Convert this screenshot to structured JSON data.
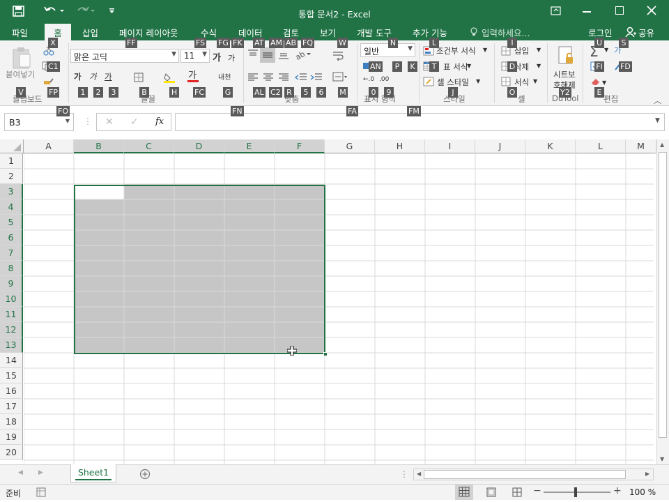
{
  "window": {
    "title": "통합 문서2  -  Excel"
  },
  "colors": {
    "accent": "#217346",
    "selection_fill": "#c6c6c6",
    "keytip_bg": "#5a5a5a"
  },
  "tabs": [
    "파일",
    "홈",
    "삽입",
    "페이지 레이아웃",
    "수식",
    "데이터",
    "검토",
    "보기",
    "개발 도구",
    "추가 기능"
  ],
  "tell_me": {
    "placeholder": "입력하세요..."
  },
  "account": {
    "login": "로그인",
    "share": "공유"
  },
  "ribbon": {
    "paste_label": "붙여넣기",
    "font_name": "맑은 고딕",
    "font_size": "11",
    "number_format": "일반",
    "conditional_format": "조건부 서식",
    "format_as_table": "표 서식",
    "cell_styles": "셀 스타일",
    "insert": "삽입",
    "delete": "삭제",
    "format": "서식",
    "sheet_protect_1": "시트보",
    "sheet_protect_2": "호해제",
    "groups": {
      "clipboard": "클립보드",
      "font": "글꼴",
      "alignment": "맞춤",
      "number": "표시 형식",
      "styles": "스타일",
      "cells": "셀",
      "dutool": "DuTool",
      "editing": "편집"
    }
  },
  "keytips": {
    "tab_home": "X",
    "format_painter": "FP",
    "copy": "C1",
    "paste": "V",
    "font_name": "FF",
    "font_size": "FS",
    "grow": "FG",
    "shrink": "FK",
    "top_align": "AT",
    "middle_align": "AM",
    "bottom_align": "AB",
    "orientation": "FQ",
    "wrap": "W",
    "number_format": "N",
    "conditional": "L",
    "insert": "I",
    "autosum": "U",
    "sort": "S",
    "bold": "1",
    "italic": "2",
    "underline": "3",
    "border": "B",
    "fill": "H",
    "font_color": "FC",
    "phonetic": "G",
    "align_left": "AL",
    "align_center": "C2",
    "align_right": "R",
    "dec_indent": "5",
    "inc_indent": "6",
    "merge": "M",
    "accounting": "AN",
    "percent": "P",
    "comma": "K",
    "table": "T",
    "delete": "D",
    "fill_down": "FI",
    "find": "FD",
    "inc_decimal": "0",
    "dec_decimal": "9",
    "cell_styles": "J",
    "format": "O",
    "unprotect": "Y2",
    "clear": "E",
    "font_dialog": "FN",
    "align_dialog": "FA",
    "number_dialog": "FM",
    "clipboard_dialog": "FO"
  },
  "formula_bar": {
    "name_box": "B3",
    "fx": "fx",
    "formula": ""
  },
  "columns": [
    "A",
    "B",
    "C",
    "D",
    "E",
    "F",
    "G",
    "H",
    "I",
    "J",
    "K",
    "L",
    "M"
  ],
  "rows": [
    "1",
    "2",
    "3",
    "4",
    "5",
    "6",
    "7",
    "8",
    "9",
    "10",
    "11",
    "12",
    "13",
    "14",
    "15",
    "16",
    "17",
    "18",
    "19",
    "20"
  ],
  "sheet_tabs": [
    "Sheet1"
  ],
  "status": {
    "ready": "준비",
    "zoom": "100 %"
  }
}
